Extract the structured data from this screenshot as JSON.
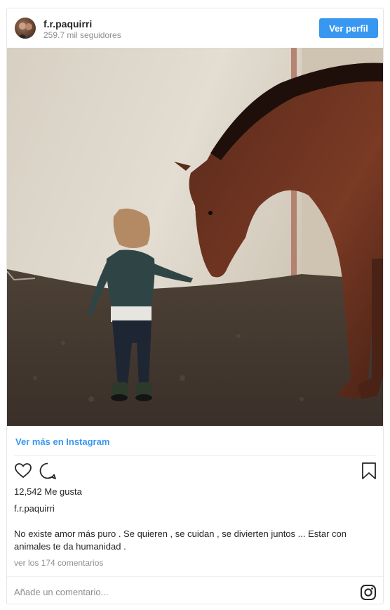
{
  "header": {
    "username": "f.r.paquirri",
    "followers": "259.7 mil seguidores",
    "view_profile_label": "Ver perfil"
  },
  "post": {
    "view_more_link": "Ver más en Instagram",
    "likes": "12,542 Me gusta",
    "caption_user": "f.r.paquirri",
    "caption": "No existe amor más puro . Se quieren , se cuidan , se divierten juntos ... Estar con animales te da humanidad .",
    "comments_link": "ver los 174 comentarios"
  },
  "comment_box": {
    "placeholder": "Añade un comentario..."
  },
  "icons": {
    "like": "heart-icon",
    "comment": "comment-bubble-icon",
    "save": "bookmark-icon",
    "brand": "instagram-icon"
  },
  "colors": {
    "accent": "#3897f0",
    "text": "#262626",
    "muted": "#8e8e8e",
    "border": "#e6e6e6"
  }
}
